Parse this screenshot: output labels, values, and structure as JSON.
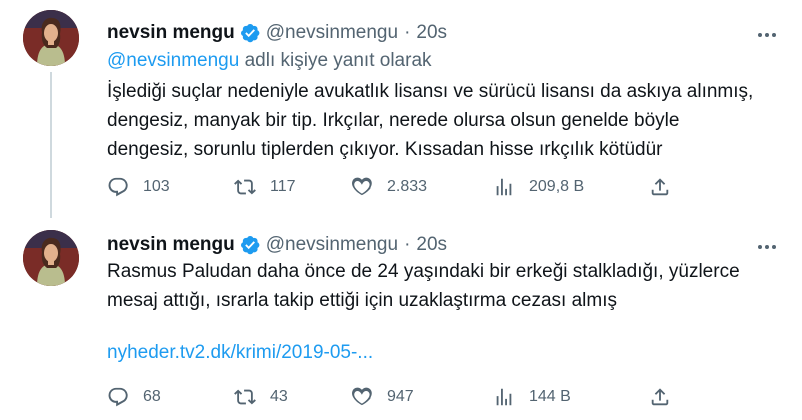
{
  "colors": {
    "accent": "#1d9bf0",
    "secondary_text": "#536471",
    "primary_text": "#0f1419",
    "thread_line": "#cfd9de"
  },
  "tweets": [
    {
      "author_name": "nevsin mengu",
      "handle": "@nevsinmengu",
      "separator": "·",
      "time": "20s",
      "verified_icon": "verified-badge-icon",
      "more_icon": "more-icon",
      "reply_mention": "@nevsinmengu",
      "reply_suffix": " adlı kişiye yanıt olarak",
      "text": "İşlediği suçlar nedeniyle avukatlık lisansı ve sürücü lisansı da askıya alınmış,\ndengesiz, manyak bir tip. Irkçılar, nerede olursa olsun genelde böyle\ndengesiz, sorunlu tiplerden çıkıyor. Kıssadan hisse ırkçılık kötüdür",
      "replies": "103",
      "retweets": "117",
      "likes": "2.833",
      "views": "209,8 B"
    },
    {
      "author_name": "nevsin mengu",
      "handle": "@nevsinmengu",
      "separator": "·",
      "time": "20s",
      "verified_icon": "verified-badge-icon",
      "more_icon": "more-icon",
      "text": "Rasmus Paludan  daha önce de 24 yaşındaki bir erkeği stalkladığı, yüzlerce\nmesaj attığı, ısrarla takip ettiği  için uzaklaştırma cezası almış",
      "link": "nyheder.tv2.dk/krimi/2019-05-...",
      "replies": "68",
      "retweets": "43",
      "likes": "947",
      "views": "144 B"
    }
  ],
  "icons": {
    "reply": "reply-icon",
    "retweet": "retweet-icon",
    "like": "heart-icon",
    "views": "views-icon",
    "share": "share-icon"
  }
}
